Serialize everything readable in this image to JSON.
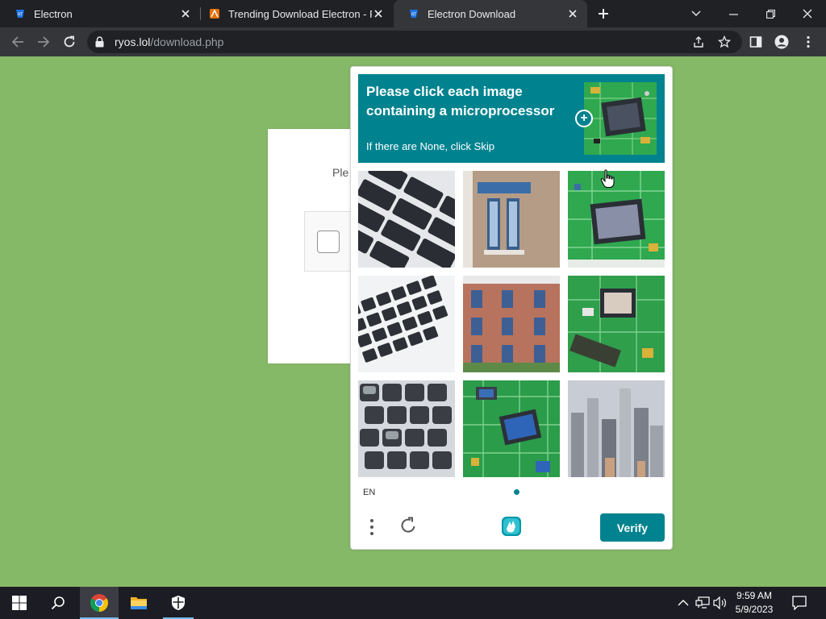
{
  "browser": {
    "tabs": [
      {
        "title": "Electron",
        "active": false
      },
      {
        "title": "Trending Download Electron - Ry",
        "active": false
      },
      {
        "title": "Electron Download",
        "active": true
      }
    ],
    "url_host": "ryos.lol",
    "url_path": "/download.php"
  },
  "page": {
    "prompt_partial": "Ple"
  },
  "captcha": {
    "prompt": "Please click each image containing a microprocessor",
    "subtext": "If there are None, click Skip",
    "grid": [
      {
        "row": 1,
        "col": 1,
        "subject": "keyboard"
      },
      {
        "row": 1,
        "col": 2,
        "subject": "building"
      },
      {
        "row": 1,
        "col": 3,
        "subject": "microprocessor"
      },
      {
        "row": 2,
        "col": 1,
        "subject": "keyboard"
      },
      {
        "row": 2,
        "col": 2,
        "subject": "building"
      },
      {
        "row": 2,
        "col": 3,
        "subject": "microprocessor"
      },
      {
        "row": 3,
        "col": 1,
        "subject": "keyboard"
      },
      {
        "row": 3,
        "col": 2,
        "subject": "microprocessor"
      },
      {
        "row": 3,
        "col": 3,
        "subject": "city"
      }
    ],
    "language": "EN",
    "verify_label": "Verify",
    "accent_color": "#00838f"
  },
  "taskbar": {
    "time": "9:59 AM",
    "date": "5/9/2023",
    "pinned": [
      "start-icon",
      "search-icon",
      "chrome-icon",
      "file-explorer-icon",
      "defender-icon"
    ]
  }
}
